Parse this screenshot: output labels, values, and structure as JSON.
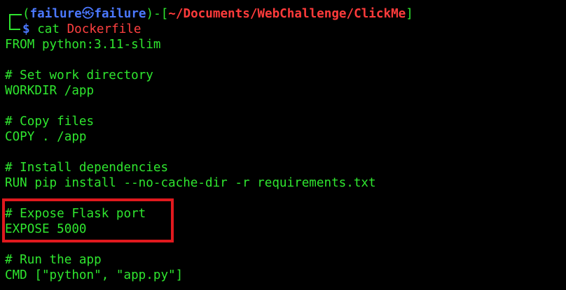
{
  "prompt": {
    "open_paren": "(",
    "user": "failure",
    "at": "㉿",
    "host": "failure",
    "close_paren": ")",
    "dash": "-",
    "open_bracket": "[",
    "path": "~/Documents/WebChallenge/ClickMe",
    "close_bracket": "]",
    "dollar": "$",
    "command": "cat",
    "argument": "Dockerfile"
  },
  "output_lines": [
    "FROM python:3.11-slim",
    "",
    "# Set work directory",
    "WORKDIR /app",
    "",
    "# Copy files",
    "COPY . /app",
    "",
    "# Install dependencies",
    "RUN pip install --no-cache-dir -r requirements.txt",
    "",
    "# Expose Flask port",
    "EXPOSE 5000",
    "",
    "# Run the app",
    "CMD [\"python\", \"app.py\"]"
  ],
  "colors": {
    "background": "#000000",
    "text_green": "#2fe62f",
    "user_blue": "#4b78ff",
    "path_red": "#ff4040",
    "highlight_red": "#e0191e"
  }
}
